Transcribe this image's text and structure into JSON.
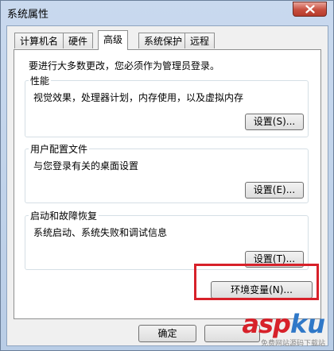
{
  "window": {
    "title": "系统属性"
  },
  "tabs": [
    {
      "label": "计算机名",
      "active": false
    },
    {
      "label": "硬件",
      "active": false
    },
    {
      "label": "高级",
      "active": true
    },
    {
      "label": "系统保护",
      "active": false
    },
    {
      "label": "远程",
      "active": false
    }
  ],
  "panel": {
    "note": "要进行大多数更改，您必须作为管理员登录。",
    "groups": [
      {
        "title": "性能",
        "description": "视觉效果，处理器计划，内存使用，以及虚拟内存",
        "button": "设置(S)..."
      },
      {
        "title": "用户配置文件",
        "description": "与您登录有关的桌面设置",
        "button": "设置(E)..."
      },
      {
        "title": "启动和故障恢复",
        "description": "系统启动、系统失败和调试信息",
        "button": "设置(T)..."
      }
    ],
    "env_button": "环境变量(N)..."
  },
  "footer": {
    "ok": "确定"
  },
  "watermark": {
    "brand_a": "asp",
    "brand_b": "ku",
    "sub": "免费网站源码下载站"
  },
  "colors": {
    "highlight": "#d7212a",
    "brand_red": "#d7212a",
    "brand_blue": "#2f78c8"
  }
}
